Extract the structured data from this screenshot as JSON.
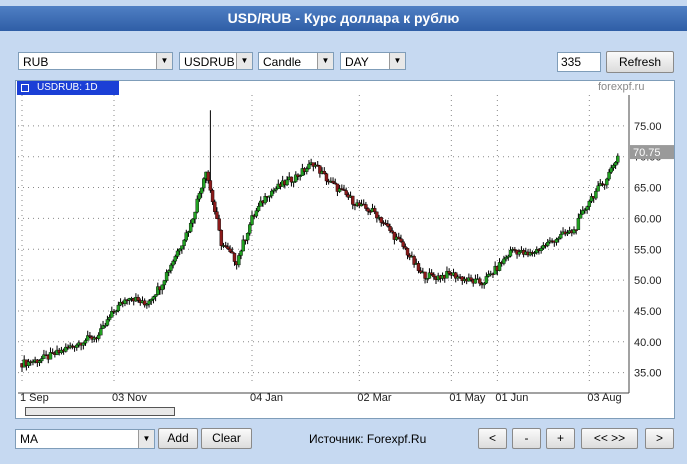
{
  "title": "USD/RUB - Курс доллара к рублю",
  "toolbar": {
    "currency": "RUB",
    "symbol": "USDRUB",
    "chart_type": "Candle",
    "period": "DAY",
    "bars": "335",
    "refresh": "Refresh"
  },
  "chart": {
    "tag": "USDRUB: 1D",
    "brand": "forexpf.ru",
    "last_price": "70.75"
  },
  "bottom": {
    "indicator": "MA",
    "add": "Add",
    "clear": "Clear",
    "source": "Источник: Forexpf.Ru",
    "nav_prev": "<",
    "zoom_out": "-",
    "zoom_in": "+",
    "nav_range": "<< >>",
    "nav_next": ">"
  },
  "chart_data": {
    "type": "candlestick",
    "x_ticks": [
      "1 Sep",
      "03 Nov",
      "04 Jan",
      "02 Mar",
      "01 May",
      "01 Jun",
      "03 Aug"
    ],
    "y_ticks": [
      35.0,
      40.0,
      45.0,
      50.0,
      55.0,
      60.0,
      65.0,
      70.0,
      75.0
    ],
    "ylim": [
      33,
      80
    ],
    "grid": true,
    "series": [
      {
        "x": "1 Sep",
        "y": 36.5
      },
      {
        "x": "Sep",
        "y": 37.0
      },
      {
        "x": "Sep",
        "y": 37.8
      },
      {
        "x": "Oct",
        "y": 39.0
      },
      {
        "x": "Oct",
        "y": 40.2
      },
      {
        "x": "Oct",
        "y": 41.0
      },
      {
        "x": "03 Nov",
        "y": 45.0
      },
      {
        "x": "Nov",
        "y": 47.5
      },
      {
        "x": "Nov",
        "y": 46.0
      },
      {
        "x": "Nov",
        "y": 49.0
      },
      {
        "x": "Dec",
        "y": 54.0
      },
      {
        "x": "Dec",
        "y": 59.0
      },
      {
        "x": "Dec",
        "y": 68.0
      },
      {
        "x": "Dec",
        "y": 56.0
      },
      {
        "x": "Dec",
        "y": 53.0
      },
      {
        "x": "04 Jan",
        "y": 60.0
      },
      {
        "x": "Jan",
        "y": 64.0
      },
      {
        "x": "Jan",
        "y": 65.5
      },
      {
        "x": "Jan",
        "y": 67.0
      },
      {
        "x": "Feb",
        "y": 69.0
      },
      {
        "x": "Feb",
        "y": 66.0
      },
      {
        "x": "Feb",
        "y": 64.0
      },
      {
        "x": "02 Mar",
        "y": 62.0
      },
      {
        "x": "Mar",
        "y": 61.0
      },
      {
        "x": "Mar",
        "y": 58.0
      },
      {
        "x": "Apr",
        "y": 55.0
      },
      {
        "x": "Apr",
        "y": 51.0
      },
      {
        "x": "Apr",
        "y": 50.5
      },
      {
        "x": "01 May",
        "y": 51.0
      },
      {
        "x": "May",
        "y": 50.0
      },
      {
        "x": "May",
        "y": 49.5
      },
      {
        "x": "01 Jun",
        "y": 52.0
      },
      {
        "x": "Jun",
        "y": 55.0
      },
      {
        "x": "Jun",
        "y": 54.0
      },
      {
        "x": "Jul",
        "y": 55.5
      },
      {
        "x": "Jul",
        "y": 57.0
      },
      {
        "x": "Jul",
        "y": 58.0
      },
      {
        "x": "03 Aug",
        "y": 63.0
      },
      {
        "x": "Aug",
        "y": 66.0
      },
      {
        "x": "Aug",
        "y": 70.75
      }
    ]
  }
}
